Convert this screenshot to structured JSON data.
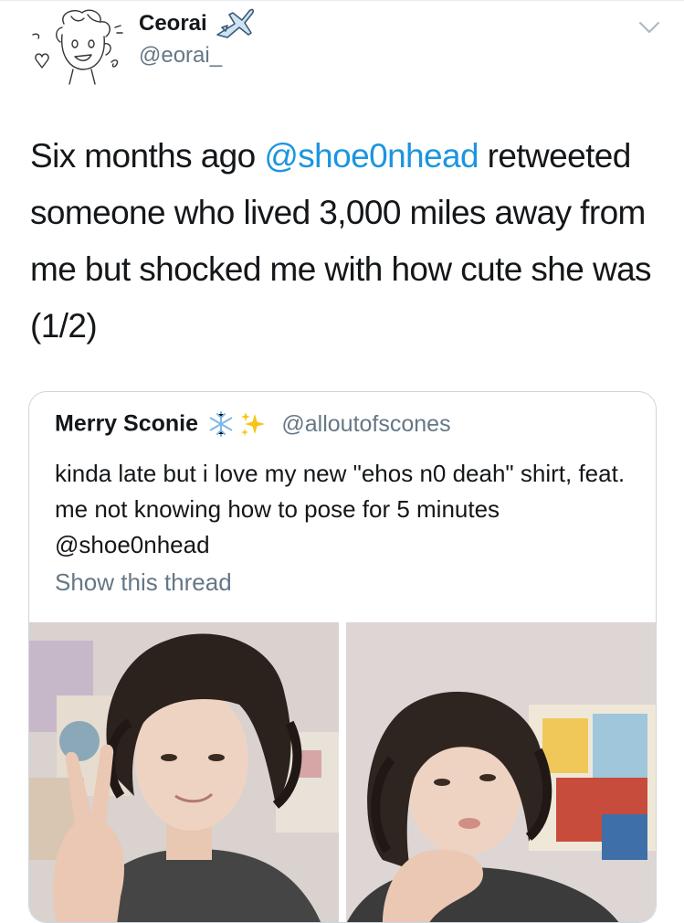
{
  "author": {
    "display_name": "Ceorai",
    "handle": "@eorai_",
    "badge_icon": "airplane-icon",
    "avatar_icon": "cartoon-avatar-icon"
  },
  "menu_icon": "chevron-down-icon",
  "tweet": {
    "text_before": "Six months ago ",
    "mention": "@shoe0nhead",
    "text_after": " retweeted someone who lived 3,000 miles away from me but shocked me with how cute she was (1/2)"
  },
  "quoted_tweet": {
    "display_name": "Merry Sconie",
    "emoji_icons": [
      "snowflake-icon",
      "sparkles-icon"
    ],
    "handle": "@alloutofscones",
    "text": "kinda late but i love my new \"ehos n0 deah\" shirt, feat. me not knowing how to pose for 5 minutes @shoe0nhead",
    "show_thread": "Show this thread",
    "photos": [
      "selfie-peace-sign-photo",
      "selfie-hand-on-chin-photo"
    ]
  },
  "colors": {
    "link": "#1b95e0",
    "secondary_text": "#657786",
    "primary_text": "#14171a",
    "border": "#ccd6dd"
  }
}
